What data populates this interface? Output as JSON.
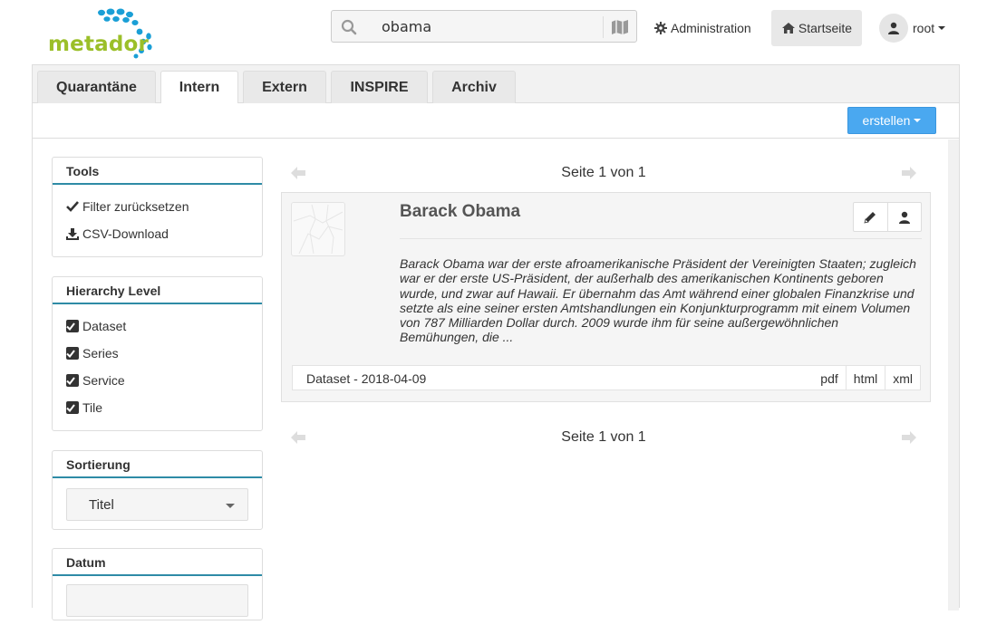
{
  "app": {
    "logo_text": "metador"
  },
  "search": {
    "value": "obama",
    "placeholder": ""
  },
  "nav": {
    "administration": "Administration",
    "home": "Startseite",
    "user": "root"
  },
  "tabs": [
    {
      "label": "Quarantäne",
      "active": false
    },
    {
      "label": "Intern",
      "active": true
    },
    {
      "label": "Extern",
      "active": false
    },
    {
      "label": "INSPIRE",
      "active": false
    },
    {
      "label": "Archiv",
      "active": false
    }
  ],
  "toolbar": {
    "create_label": "erstellen"
  },
  "sidebar": {
    "tools": {
      "title": "Tools",
      "reset": "Filter zurücksetzen",
      "csv": "CSV-Download"
    },
    "hierarchy": {
      "title": "Hierarchy Level",
      "items": [
        "Dataset",
        "Series",
        "Service",
        "Tile"
      ]
    },
    "sort": {
      "title": "Sortierung",
      "selected": "Titel"
    },
    "date": {
      "title": "Datum"
    }
  },
  "pagination": {
    "text": "Seite 1 von 1"
  },
  "result": {
    "title": "Barack Obama",
    "description": "Barack Obama war der erste afroamerikanische Präsident der Vereinigten Staaten; zugleich war er der erste US-Präsident, der außerhalb des amerikanischen Kontinents geboren wurde, und zwar auf Hawaii. Er übernahm das Amt während einer globalen Finanzkrise und setzte als eine seiner ersten Amtshandlungen ein Konjunkturprogramm mit einem Volumen von 787 Milliarden Dollar durch. 2009 wurde ihm für seine außergewöhnlichen Bemühungen, die ...",
    "meta": "Dataset - 2018-04-09",
    "formats": [
      "pdf",
      "html",
      "xml"
    ]
  },
  "colors": {
    "accent": "#2e8ba6",
    "primary_button": "#4aa8f0",
    "logo_green": "#9bbf29",
    "logo_blue": "#1a9fd6"
  }
}
